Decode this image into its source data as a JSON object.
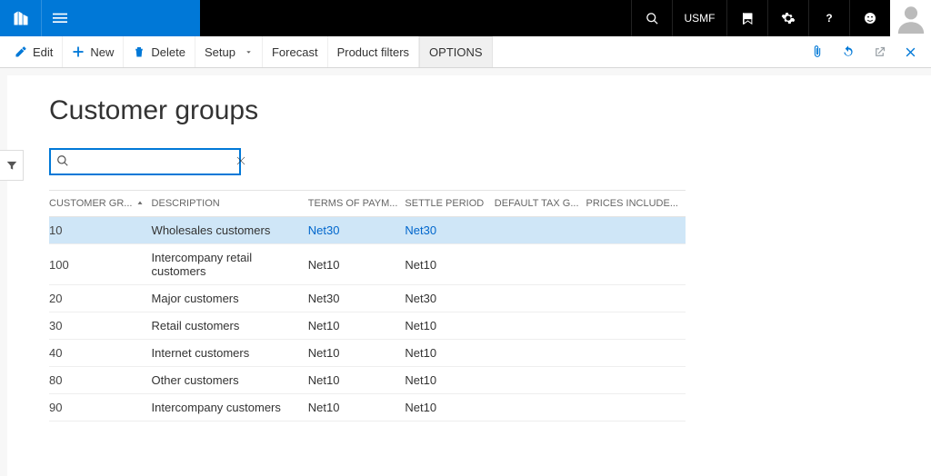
{
  "topbar": {
    "company": "USMF"
  },
  "actions": {
    "edit": "Edit",
    "new": "New",
    "delete": "Delete",
    "setup": "Setup",
    "forecast": "Forecast",
    "product_filters": "Product filters",
    "options": "OPTIONS"
  },
  "page": {
    "title": "Customer groups"
  },
  "search": {
    "value": "",
    "placeholder": ""
  },
  "grid": {
    "columns": {
      "customer_group": "CUSTOMER GR...",
      "description": "DESCRIPTION",
      "terms": "TERMS OF PAYM...",
      "settle": "SETTLE PERIOD",
      "tax": "DEFAULT TAX G...",
      "prices": "PRICES INCLUDE..."
    },
    "rows": [
      {
        "group": "10",
        "desc": "Wholesales customers",
        "terms": "Net30",
        "settle": "Net30",
        "tax": "",
        "prices": "",
        "selected": true
      },
      {
        "group": "100",
        "desc": "Intercompany retail customers",
        "terms": "Net10",
        "settle": "Net10",
        "tax": "",
        "prices": ""
      },
      {
        "group": "20",
        "desc": "Major customers",
        "terms": "Net30",
        "settle": "Net30",
        "tax": "",
        "prices": ""
      },
      {
        "group": "30",
        "desc": "Retail customers",
        "terms": "Net10",
        "settle": "Net10",
        "tax": "",
        "prices": ""
      },
      {
        "group": "40",
        "desc": "Internet customers",
        "terms": "Net10",
        "settle": "Net10",
        "tax": "",
        "prices": ""
      },
      {
        "group": "80",
        "desc": "Other customers",
        "terms": "Net10",
        "settle": "Net10",
        "tax": "",
        "prices": ""
      },
      {
        "group": "90",
        "desc": "Intercompany  customers",
        "terms": "Net10",
        "settle": "Net10",
        "tax": "",
        "prices": ""
      }
    ]
  }
}
